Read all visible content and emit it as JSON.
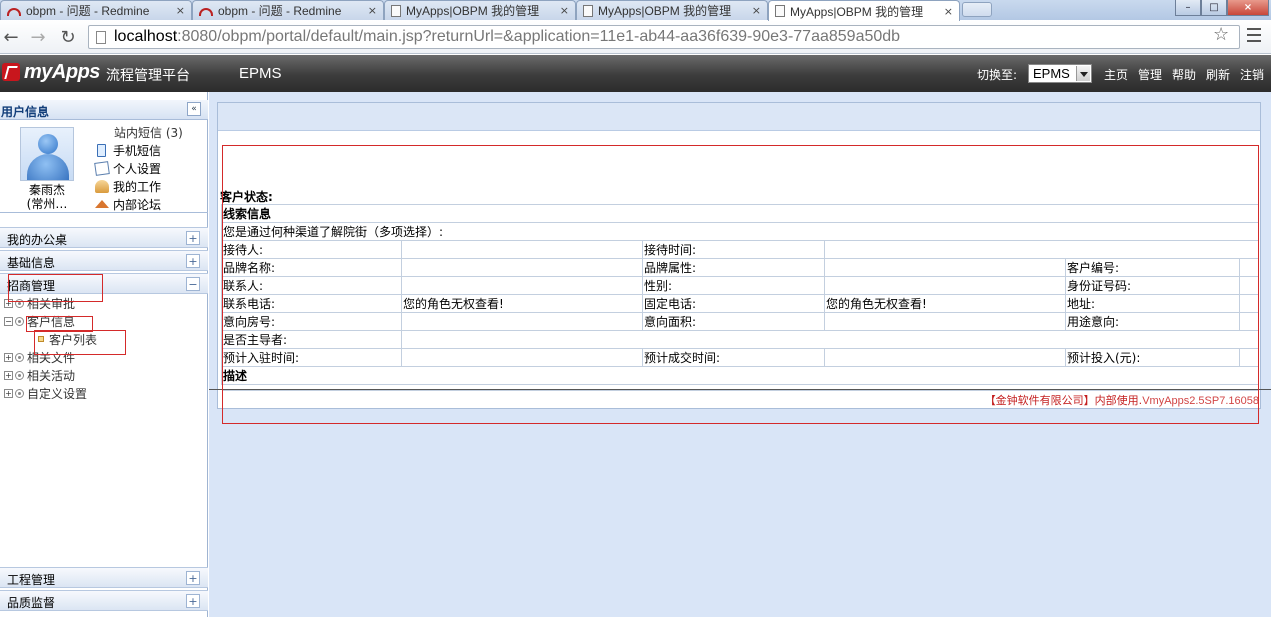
{
  "browser": {
    "tabs": [
      {
        "title": "obpm - 问题 - Redmine",
        "icon": "redmine-icon",
        "active": false
      },
      {
        "title": "obpm - 问题 - Redmine",
        "icon": "redmine-icon",
        "active": false
      },
      {
        "title": "MyApps|OBPM 我的管理",
        "icon": "page-icon",
        "active": false
      },
      {
        "title": "MyApps|OBPM 我的管理",
        "icon": "page-icon",
        "active": false
      },
      {
        "title": "MyApps|OBPM 我的管理",
        "icon": "page-icon",
        "active": true
      }
    ],
    "close_glyph": "×",
    "url_host": "localhost",
    "url_rest": ":8080/obpm/portal/default/main.jsp?returnUrl=&application=11e1-ab44-aa36f639-90e3-77aa859a50db",
    "window_buttons": {
      "minimize": "–",
      "maximize": "□",
      "close": "×"
    },
    "nav": {
      "back": "←",
      "forward": "→",
      "reload": "↻",
      "bookmark": "☆"
    }
  },
  "header": {
    "logo_text": "myApps",
    "logo_subtitle": "流程管理平台",
    "app_name": "EPMS",
    "switch_label": "切换至:",
    "switch_value": "EPMS",
    "links": [
      "主页",
      "管理",
      "帮助",
      "刷新",
      "注销"
    ]
  },
  "sidebar": {
    "title": "用户信息",
    "collapse_glyph": "«",
    "user_name_line1": "秦雨杰",
    "user_name_line2": "(常州…",
    "user_links": [
      {
        "label": "站内短信 (3)",
        "icon": ""
      },
      {
        "label": "手机短信",
        "icon": "phone-icon"
      },
      {
        "label": "个人设置",
        "icon": "edit-icon"
      },
      {
        "label": "我的工作",
        "icon": "work-icon"
      },
      {
        "label": "内部论坛",
        "icon": "home-icon"
      }
    ],
    "sections": [
      {
        "label": "我的办公桌",
        "toggle": "+"
      },
      {
        "label": "基础信息",
        "toggle": "+"
      },
      {
        "label": "招商管理",
        "toggle": "−"
      },
      {
        "label": "工程管理",
        "toggle": "+"
      },
      {
        "label": "品质监督",
        "toggle": "+"
      }
    ],
    "tree": [
      {
        "label": "相关审批",
        "toggle": "+"
      },
      {
        "label": "客户信息",
        "toggle": "−"
      },
      {
        "label": "相关文件",
        "toggle": "+"
      },
      {
        "label": "相关活动",
        "toggle": "+"
      },
      {
        "label": "自定义设置",
        "toggle": "+"
      }
    ],
    "tree_leaf": "客户列表"
  },
  "form": {
    "status_label": "客户状态:",
    "section_clue": "线索信息",
    "channel_question": "您是通过何种渠道了解院街（多项选择）:",
    "rows": [
      [
        "接待人:",
        "",
        "接待时间:",
        "",
        "",
        ""
      ],
      [
        "品牌名称:",
        "",
        "品牌属性:",
        "",
        "客户编号:",
        ""
      ],
      [
        "联系人:",
        "",
        "性别:",
        "",
        "身份证号码:",
        ""
      ],
      [
        "联系电话:",
        "您的角色无权查看!",
        "固定电话:",
        "您的角色无权查看!",
        "地址:",
        ""
      ],
      [
        "意向房号:",
        "",
        "意向面积:",
        "",
        "用途意向:",
        ""
      ],
      [
        "是否主导者:",
        "",
        "",
        "",
        "",
        ""
      ],
      [
        "预计入驻时间:",
        "",
        "预计成交时间:",
        "",
        "预计投入(元):",
        ""
      ]
    ],
    "section_desc": "描述",
    "copyright": "【金钟软件有限公司】内部使用.",
    "version": "VmyApps2.5SP7.16058"
  }
}
